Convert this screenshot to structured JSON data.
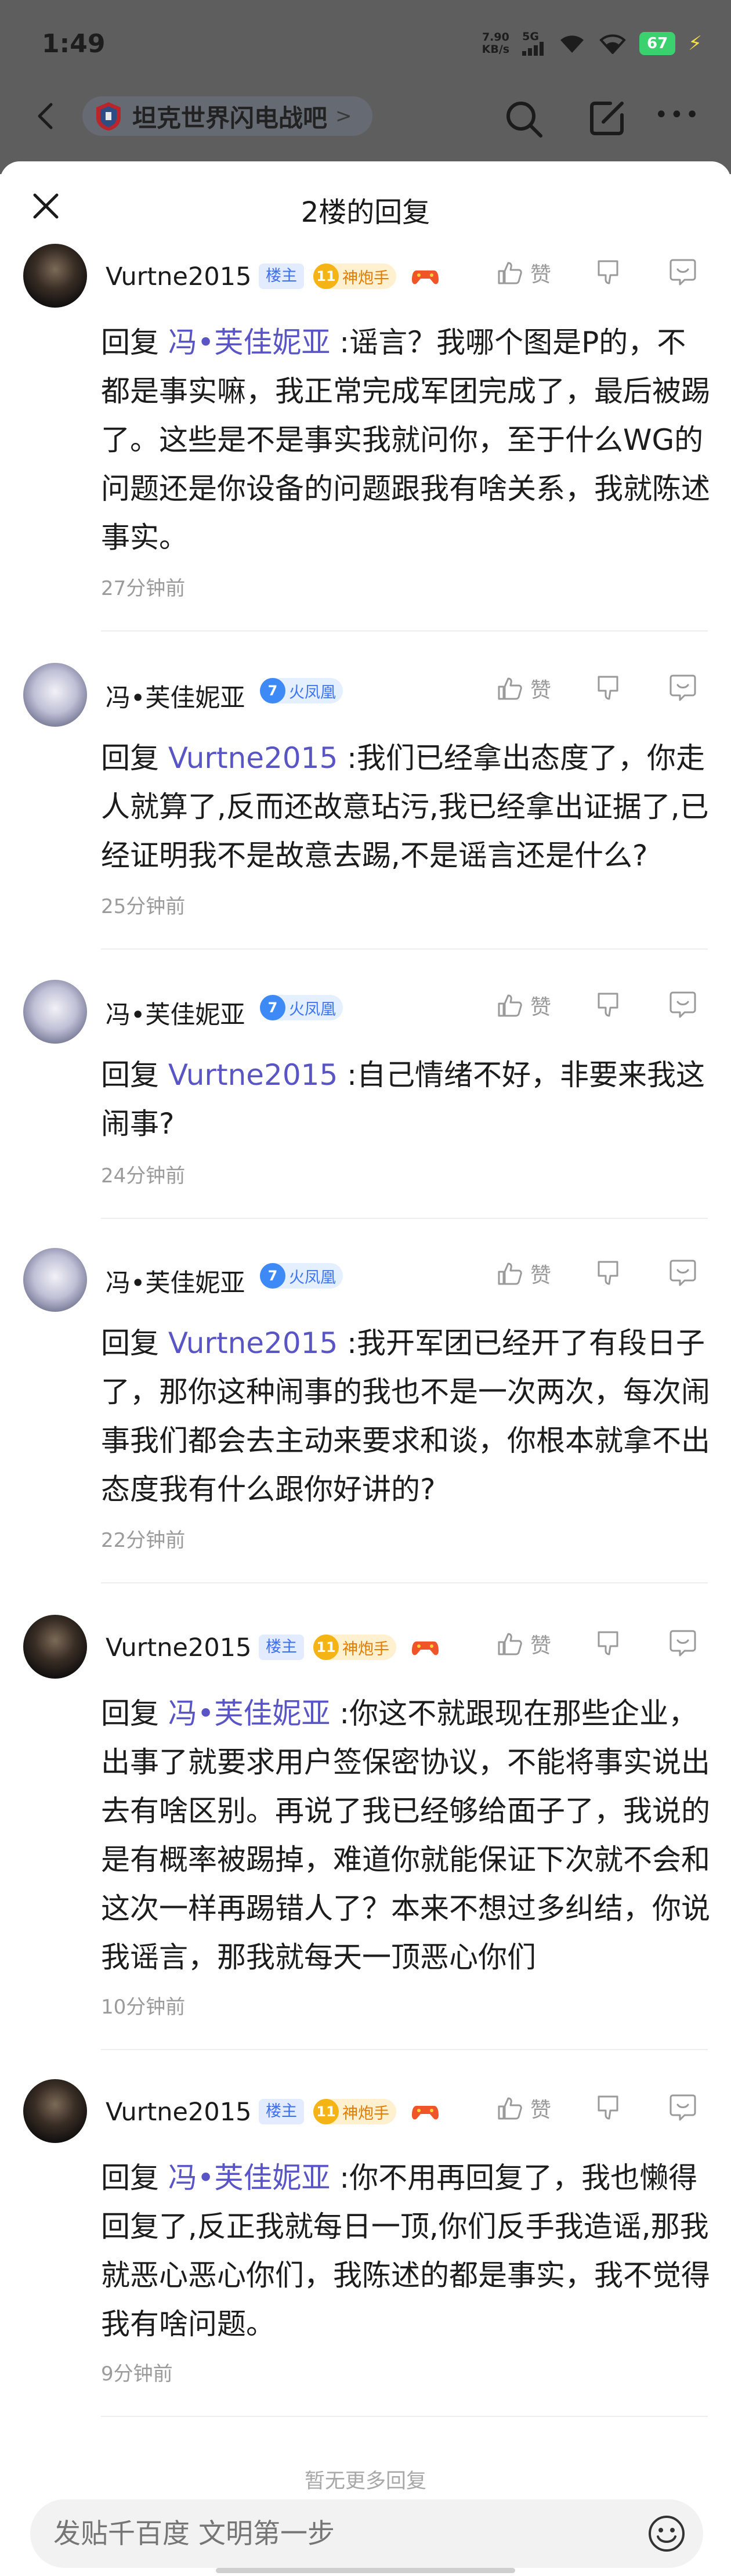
{
  "status_bar": {
    "time": "1:49",
    "net_speed_value": "7.90",
    "net_speed_unit": "KB/s",
    "signal_label": "5G",
    "battery": "67"
  },
  "nav": {
    "forum_name": "坦克世界闪电战吧",
    "forum_chevron": ">"
  },
  "sheet": {
    "title": "2楼的回复"
  },
  "actions": {
    "like_label": "赞"
  },
  "badges": {
    "owner": "楼主",
    "level_11": "11",
    "title_gunner": "神炮手",
    "level_7": "7",
    "title_phoenix": "火凤凰"
  },
  "replies": [
    {
      "username": "Vurtne2015",
      "reply_prefix": "回复 ",
      "mention": "冯•芙佳妮亚",
      "text": " :谣言？我哪个图是P的，不都是事实嘛，我正常完成军团完成了，最后被踢了。这些是不是事实我就问你，至于什么WG的问题还是你设备的问题跟我有啥关系，我就陈述事实。",
      "time": "27分钟前"
    },
    {
      "username": "冯•芙佳妮亚",
      "reply_prefix": "回复 ",
      "mention": "Vurtne2015",
      "text": " :我们已经拿出态度了，你走人就算了,反而还故意玷污,我已经拿出证据了,已经证明我不是故意去踢,不是谣言还是什么?",
      "time": "25分钟前"
    },
    {
      "username": "冯•芙佳妮亚",
      "reply_prefix": "回复 ",
      "mention": "Vurtne2015",
      "text": " :自己情绪不好，非要来我这闹事?",
      "time": "24分钟前"
    },
    {
      "username": "冯•芙佳妮亚",
      "reply_prefix": "回复 ",
      "mention": "Vurtne2015",
      "text": " :我开军团已经开了有段日子了，那你这种闹事的我也不是一次两次，每次闹事我们都会去主动来要求和谈，你根本就拿不出态度我有什么跟你好讲的?",
      "time": "22分钟前"
    },
    {
      "username": "Vurtne2015",
      "reply_prefix": "回复 ",
      "mention": "冯•芙佳妮亚",
      "text": " :你这不就跟现在那些企业，出事了就要求用户签保密协议，不能将事实说出去有啥区别。再说了我已经够给面子了，我说的是有概率被踢掉，难道你就能保证下次就不会和这次一样再踢错人了？本来不想过多纠结，你说我谣言，那我就每天一顶恶心你们",
      "time": "10分钟前"
    },
    {
      "username": "Vurtne2015",
      "reply_prefix": "回复 ",
      "mention": "冯•芙佳妮亚",
      "text": " :你不用再回复了，我也懒得回复了,反正我就每日一顶,你们反手我造谣,那我就恶心恶心你们，我陈述的都是事实，我不觉得我有啥问题。",
      "time": "9分钟前"
    }
  ],
  "footer": {
    "no_more": "暂无更多回复",
    "compose_placeholder": "发贴千百度 文明第一步"
  },
  "colors": {
    "mention": "#5a55c4",
    "owner_badge": "#3a6ff2",
    "gold_badge": "#e17c00",
    "blue_badge": "#3d76f2"
  }
}
